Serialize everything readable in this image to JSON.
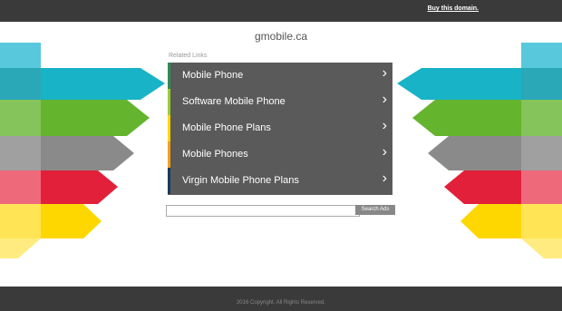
{
  "header": {
    "buy_label": "Buy this domain."
  },
  "domain": "gmobile.ca",
  "related_label": "Related Links",
  "links": [
    {
      "label": "Mobile Phone",
      "accent": "#2e8b57"
    },
    {
      "label": "Software Mobile Phone",
      "accent": "#9acd32"
    },
    {
      "label": "Mobile Phone Plans",
      "accent": "#ffd700"
    },
    {
      "label": "Mobile Phones",
      "accent": "#f4a020"
    },
    {
      "label": "Virgin Mobile Phone Plans",
      "accent": "#1a3a5a"
    }
  ],
  "search": {
    "placeholder": "",
    "button_label": "Search Ads"
  },
  "footer": {
    "copyright": "2016 Copyright. All Rights Reserved."
  },
  "colors": {
    "bar": "#3a3a3a",
    "teal": "#1fb5c9",
    "green": "#64b42d",
    "gray": "#8a8a8a",
    "red": "#e2203a",
    "yellow": "#ffd700"
  }
}
